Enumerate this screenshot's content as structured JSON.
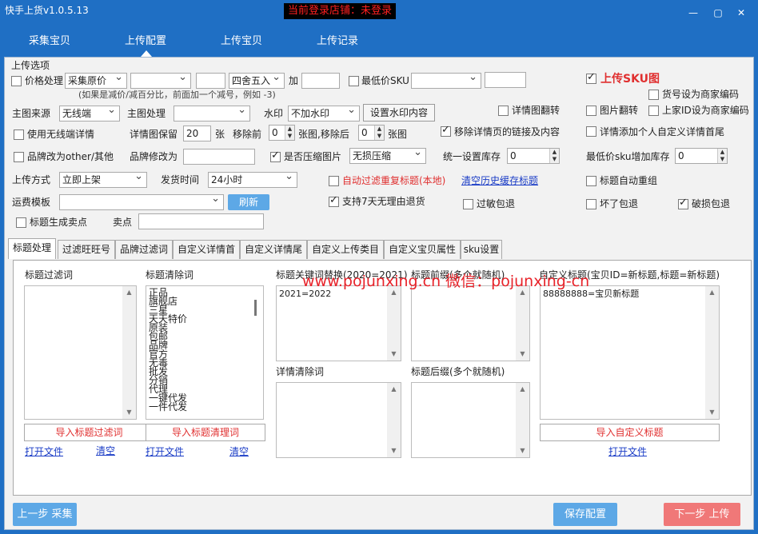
{
  "window": {
    "title": "快手上货v1.0.5.13",
    "login_status": "当前登录店铺：未登录"
  },
  "nav": {
    "tabs": [
      {
        "label": "采集宝贝"
      },
      {
        "label": "上传配置"
      },
      {
        "label": "上传宝贝"
      },
      {
        "label": "上传记录"
      }
    ],
    "active": "上传配置"
  },
  "options": {
    "group_title": "上传选项",
    "price": {
      "label": "价格处理",
      "source": "采集原价",
      "rounding": "四舍五入",
      "plus_label": "加",
      "hint": "(如果是减价/减百分比，前面加一个减号，例如 -3)"
    },
    "min_sku_label": "最低价SKU",
    "upload_sku_img_label": "上传SKU图",
    "goods_no_label": "货号设为商家编码",
    "main_img_source_label": "主图来源",
    "main_img_source_value": "无线端",
    "main_img_process_label": "主图处理",
    "watermark_label": "水印",
    "watermark_value": "不加水印",
    "watermark_btn": "设置水印内容",
    "detail_flip_label": "详情图翻转",
    "img_flip_label": "图片翻转",
    "shop_id_label": "上家ID设为商家编码",
    "use_wireless_detail_label": "使用无线端详情",
    "detail_keep_label": "详情图保留",
    "detail_keep_value": "20",
    "zhang_label": "张",
    "remove_front_label": "移除前",
    "remove_front_value": "0",
    "remove_mid_label": "张图,移除后",
    "remove_back_value": "0",
    "remove_end_label": "张图",
    "remove_links_label": "移除详情页的链接及内容",
    "add_custom_detail_label": "详情添加个人自定义详情首尾",
    "brand_other_label": "品牌改为other/其他",
    "brand_modify_label": "品牌修改为",
    "compress_label": "是否压缩图片",
    "compress_value": "无损压缩",
    "unify_stock_label": "统一设置库存",
    "unify_stock_value": "0",
    "min_sku_stock_label": "最低价sku增加库存",
    "min_sku_stock_value": "0",
    "upload_mode_label": "上传方式",
    "upload_mode_value": "立即上架",
    "ship_time_label": "发货时间",
    "ship_time_value": "24小时",
    "auto_filter_label": "自动过滤重复标题(本地)",
    "clear_cache_link": "清空历史缓存标题",
    "title_regroup_label": "标题自动重组",
    "freight_label": "运费模板",
    "refresh_btn": "刷新",
    "seven_day_label": "支持7天无理由退货",
    "allergy_label": "过敏包退",
    "broken_label": "坏了包退",
    "damage_label": "破损包退",
    "gen_selling_label": "标题生成卖点",
    "selling_label": "卖点"
  },
  "subtabs": [
    {
      "label": "标题处理"
    },
    {
      "label": "过滤旺旺号"
    },
    {
      "label": "品牌过滤词"
    },
    {
      "label": "自定义详情首"
    },
    {
      "label": "自定义详情尾"
    },
    {
      "label": "自定义上传类目"
    },
    {
      "label": "自定义宝贝属性"
    },
    {
      "label": "sku设置"
    }
  ],
  "title_panel": {
    "filter_words_label": "标题过滤词",
    "clear_words_label": "标题清除词",
    "clear_words_list": [
      "正品",
      "旗舰店",
      "三星",
      "天天特价",
      "原装",
      "包邮",
      "品牌",
      "官方",
      "无毒",
      "批发",
      "分销",
      "代理",
      "一键代发",
      "一件代发"
    ],
    "keyword_replace_label": "标题关键词替换(2020=2021)",
    "keyword_replace_value": "2021=2022",
    "prefix_label": "标题前缀(多个就随机)",
    "custom_title_label": "自定义标题(宝贝ID=新标题,标题=新标题)",
    "custom_title_value": "88888888=宝贝新标题",
    "detail_clear_label": "详情清除词",
    "suffix_label": "标题后缀(多个就随机)",
    "import_filter_btn": "导入标题过滤词",
    "import_clear_btn": "导入标题清理词",
    "import_custom_btn": "导入自定义标题",
    "open_file": "打开文件",
    "clear": "清空"
  },
  "watermark_text": "www.pojunxing.cn   微信：pojunxing-cn",
  "bottom": {
    "prev_btn": "上一步 采集",
    "save_btn": "保存配置",
    "next_btn": "下一步 上传"
  },
  "colors": {
    "titlebar": "#1f6fc4",
    "accent_blue": "#5da8e6",
    "next_red": "#f07878",
    "login_red": "#ff2020"
  }
}
